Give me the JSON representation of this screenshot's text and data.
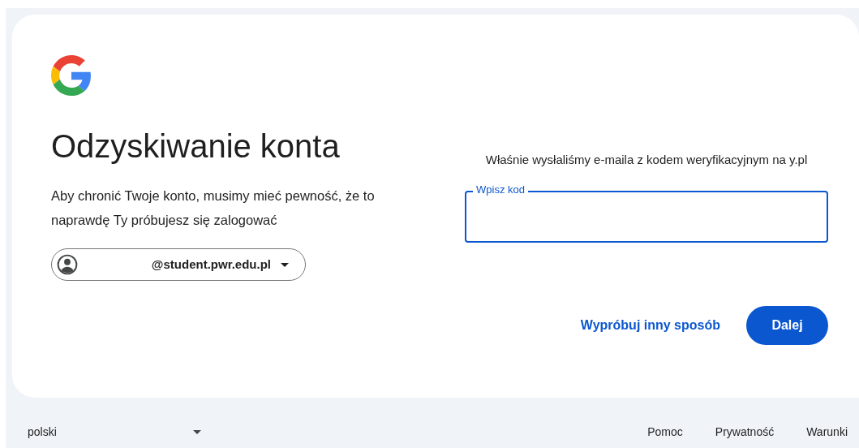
{
  "title": "Odzyskiwanie konta",
  "description": "Aby chronić Twoje konto, musimy mieć pewność, że to naprawdę Ty próbujesz się zalogować",
  "account": {
    "email": "@student.pwr.edu.pl"
  },
  "message": "Właśnie wysłaliśmy e-maila z kodem weryfikacyjnym na y.pl",
  "code_field": {
    "label": "Wpisz kod",
    "focused": true
  },
  "actions": {
    "secondary": "Wypróbuj inny sposób",
    "primary": "Dalej"
  },
  "footer": {
    "language": "polski",
    "links": [
      "Pomoc",
      "Prywatność",
      "Warunki"
    ]
  }
}
